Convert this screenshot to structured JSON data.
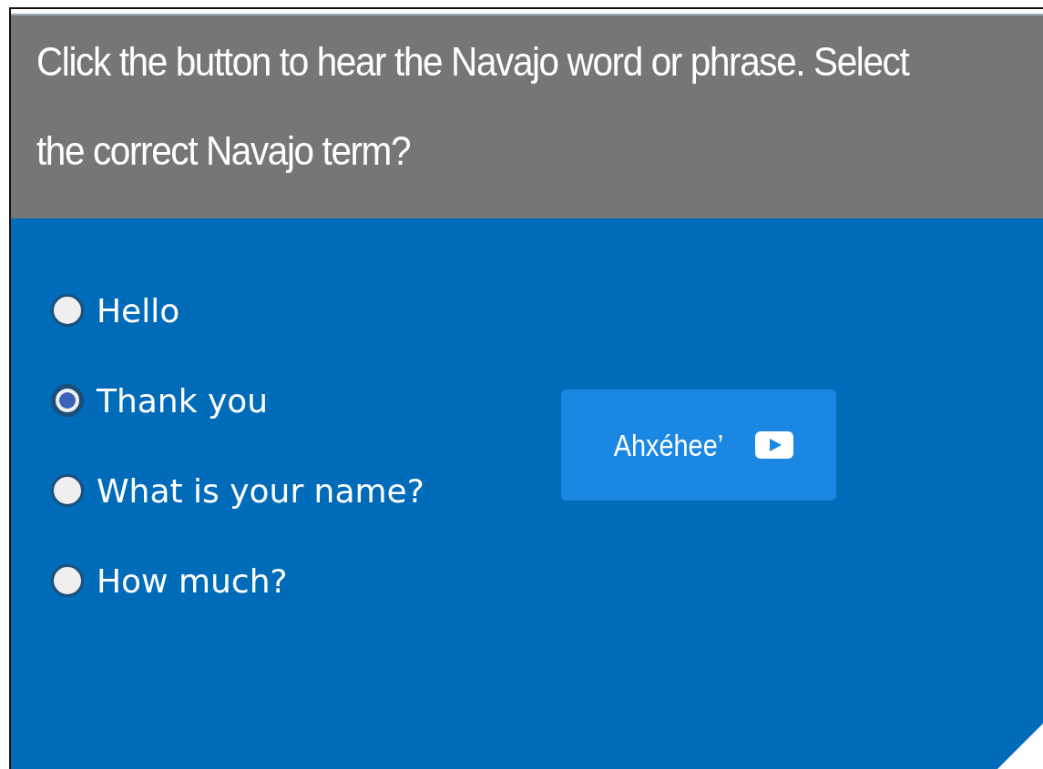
{
  "question": "Click the button to hear the Navajo word or phrase. Select the correct Navajo term?",
  "options": [
    {
      "label": "Hello",
      "selected": false
    },
    {
      "label": "Thank you",
      "selected": true
    },
    {
      "label": "What is your name?",
      "selected": false
    },
    {
      "label": "How much?",
      "selected": false
    }
  ],
  "audio_button": {
    "label": "Ahxéhee’"
  }
}
